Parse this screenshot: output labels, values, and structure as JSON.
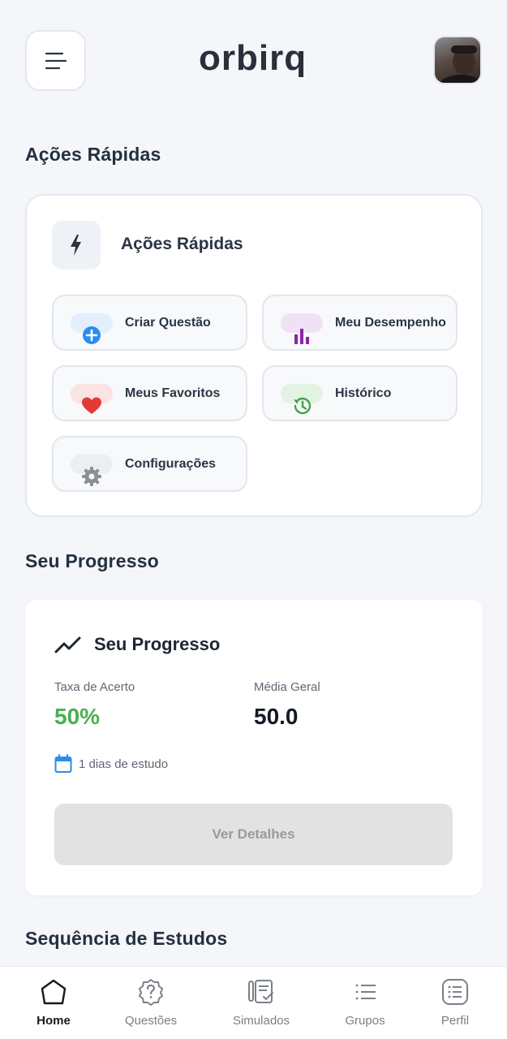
{
  "header": {
    "logo_text": "orbirq",
    "menu_icon": "menu-icon",
    "avatar_icon": "user-avatar"
  },
  "quick_actions": {
    "section_title": "Ações Rápidas",
    "card_title": "Ações Rápidas",
    "items": [
      {
        "label": "Criar Questão",
        "icon": "add-circle-icon",
        "color": "#2b8cf0"
      },
      {
        "label": "Meu Desempenho",
        "icon": "bar-chart-icon",
        "color": "#8e24aa"
      },
      {
        "label": "Meus Favoritos",
        "icon": "heart-icon",
        "color": "#e53935"
      },
      {
        "label": "Histórico",
        "icon": "history-icon",
        "color": "#43a047"
      },
      {
        "label": "Configurações",
        "icon": "gear-icon",
        "color": "#8a8f96"
      }
    ]
  },
  "progress": {
    "section_title": "Seu Progresso",
    "card_title": "Seu Progresso",
    "accuracy_label": "Taxa de Acerto",
    "accuracy_value": "50%",
    "average_label": "Média Geral",
    "average_value": "50.0",
    "study_days": "1 dias de estudo",
    "details_button": "Ver Detalhes",
    "accent_color": "#4caf50"
  },
  "streak": {
    "section_title": "Sequência de Estudos"
  },
  "nav": {
    "items": [
      {
        "label": "Home",
        "icon": "home-icon",
        "active": true
      },
      {
        "label": "Questões",
        "icon": "question-icon",
        "active": false
      },
      {
        "label": "Simulados",
        "icon": "exam-icon",
        "active": false
      },
      {
        "label": "Grupos",
        "icon": "list-icon",
        "active": false
      },
      {
        "label": "Perfil",
        "icon": "profile-icon",
        "active": false
      }
    ]
  }
}
